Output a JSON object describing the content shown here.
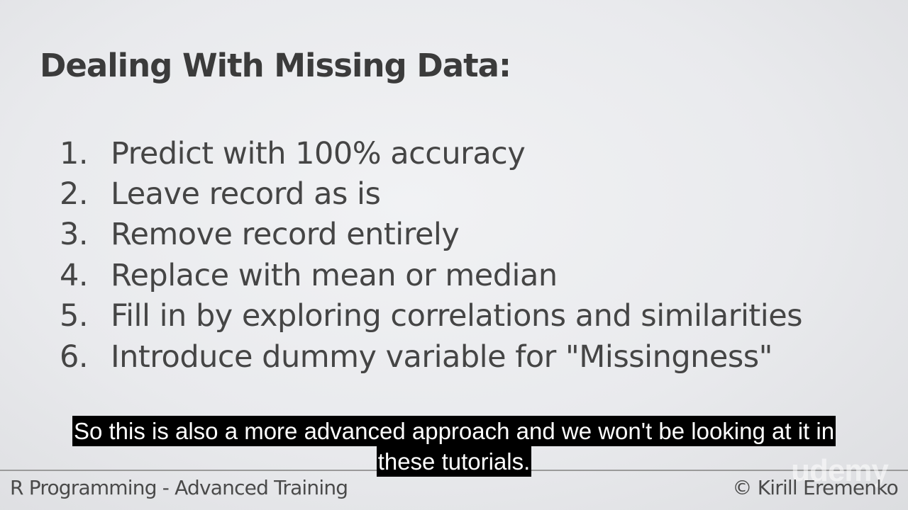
{
  "slide": {
    "title": "Dealing With Missing Data:",
    "items": [
      {
        "num": "1.",
        "text": "Predict with 100% accuracy"
      },
      {
        "num": "2.",
        "text": "Leave record as is"
      },
      {
        "num": "3.",
        "text": "Remove record entirely"
      },
      {
        "num": "4.",
        "text": "Replace with mean or median"
      },
      {
        "num": "5.",
        "text": "Fill in by exploring correlations and similarities"
      },
      {
        "num": "6.",
        "text": "Introduce dummy variable for \"Missingness\""
      }
    ]
  },
  "footer": {
    "course": "R Programming - Advanced Training",
    "author": "© Kirill Eremenko",
    "watermark": "udemy"
  },
  "subtitle": {
    "line1": "So this is also a more advanced approach and we won't be looking at it in",
    "line2": "these tutorials."
  }
}
